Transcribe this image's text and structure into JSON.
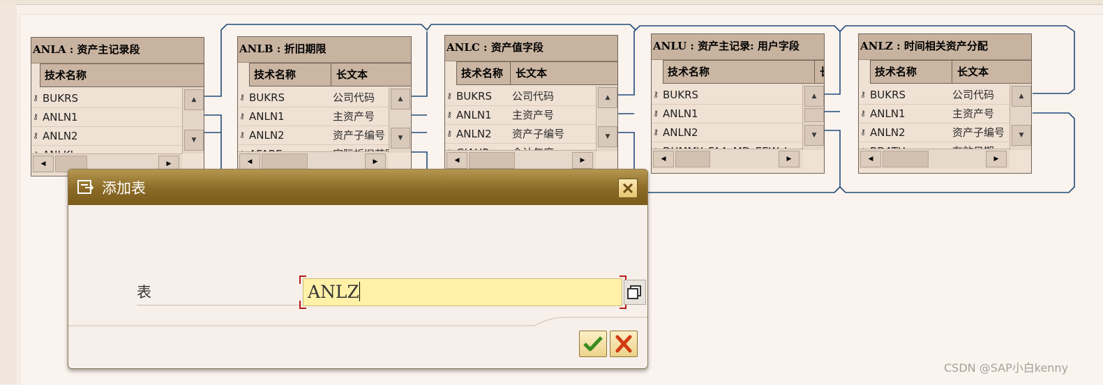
{
  "tables": [
    {
      "title": "ANLA : 资产主记录段",
      "header": {
        "col1": "技术名称",
        "col2": ""
      },
      "rows": [
        {
          "field": "BUKRS",
          "desc": ""
        },
        {
          "field": "ANLN1",
          "desc": ""
        },
        {
          "field": "ANLN2",
          "desc": ""
        },
        {
          "field": "ANLKL",
          "desc": ""
        }
      ]
    },
    {
      "title": "ANLB : 折旧期限",
      "header": {
        "col1": "技术名称",
        "col2": "长文本"
      },
      "rows": [
        {
          "field": "BUKRS",
          "desc": "公司代码"
        },
        {
          "field": "ANLN1",
          "desc": "主资产号"
        },
        {
          "field": "ANLN2",
          "desc": "资产子编号"
        },
        {
          "field": "AFABE",
          "desc": "实际折旧范围"
        }
      ]
    },
    {
      "title": "ANLC : 资产值字段",
      "header": {
        "col1": "技术名称",
        "col2": "长文本"
      },
      "rows": [
        {
          "field": "BUKRS",
          "desc": "公司代码"
        },
        {
          "field": "ANLN1",
          "desc": "主资产号"
        },
        {
          "field": "ANLN2",
          "desc": "资产子编号"
        },
        {
          "field": "GJAHR",
          "desc": "会计年度"
        }
      ]
    },
    {
      "title": "ANLU : 资产主记录: 用户字段",
      "header": {
        "col1": "技术名称",
        "col2": "长"
      },
      "rows": [
        {
          "field": "BUKRS",
          "desc": ""
        },
        {
          "field": "ANLN1",
          "desc": ""
        },
        {
          "field": "ANLN2",
          "desc": ""
        },
        {
          "field": "DUMMY_FAA_MD_EEW_I",
          "desc": ""
        }
      ]
    },
    {
      "title": "ANLZ : 时间相关资产分配",
      "header": {
        "col1": "技术名称",
        "col2": "长文本"
      },
      "rows": [
        {
          "field": "BUKRS",
          "desc": "公司代码"
        },
        {
          "field": "ANLN1",
          "desc": "主资产号"
        },
        {
          "field": "ANLN2",
          "desc": "资产子编号"
        },
        {
          "field": "BDATU",
          "desc": "有效日期"
        }
      ]
    }
  ],
  "dialog": {
    "title": "添加表",
    "field_label": "表",
    "field_value": "ANLZ",
    "ok_icon": "checkmark-icon",
    "cancel_icon": "cancel-x-icon",
    "title_icon": "add-table-icon"
  },
  "colors": {
    "dialog_title_bar": "#8a6a25",
    "input_highlight": "#fff1a8",
    "link_lines": "#1f4a7a",
    "table_header": "#c8b3a0"
  },
  "watermark": "CSDN @SAP小白kenny"
}
